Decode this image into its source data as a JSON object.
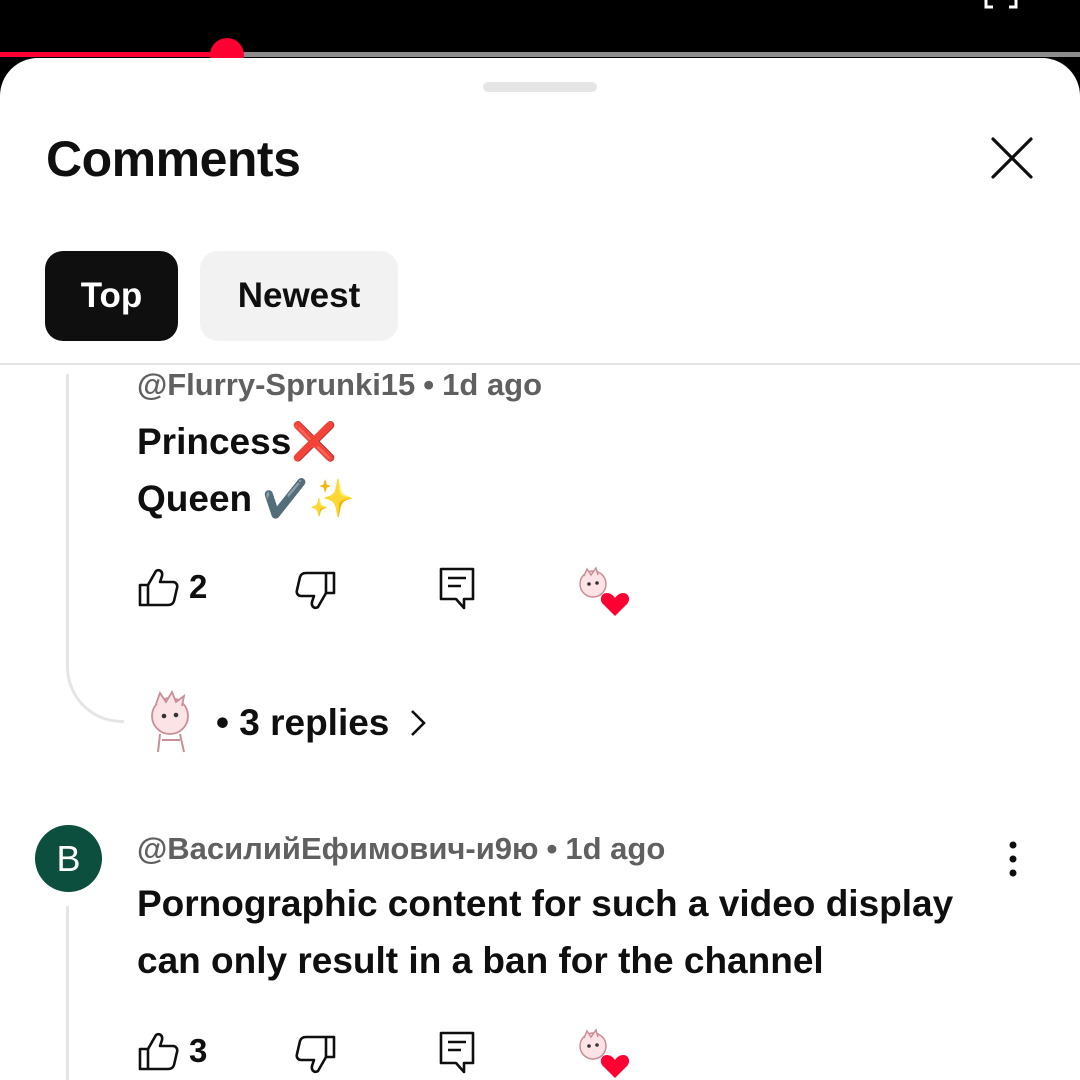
{
  "sheet": {
    "title": "Comments"
  },
  "sort_chips": {
    "top": "Top",
    "newest": "Newest"
  },
  "video": {
    "progress_fraction": 0.21,
    "accent_color": "#ff0033"
  },
  "comments": [
    {
      "author": "@Flurry-Sprunki15",
      "time": "1d ago",
      "lines": [
        "Princess❌",
        "Queen ✔️✨"
      ],
      "likes": "2",
      "replies_label": "• 3 replies",
      "creator_hearted": true
    },
    {
      "avatar_letter": "B",
      "author": "@ВасилийЕфимович-и9ю",
      "time": "1d ago",
      "lines": [
        "Pornographic content for such a video display",
        "can only result in a ban for the channel"
      ],
      "likes": "3",
      "creator_hearted": true
    }
  ],
  "icons": {
    "like": "thumbs-up-icon",
    "dislike": "thumbs-down-icon",
    "reply": "reply-icon",
    "close": "close-icon",
    "more": "more-vert-icon",
    "fullscreen": "fullscreen-icon",
    "heart": "creator-heart-icon"
  }
}
